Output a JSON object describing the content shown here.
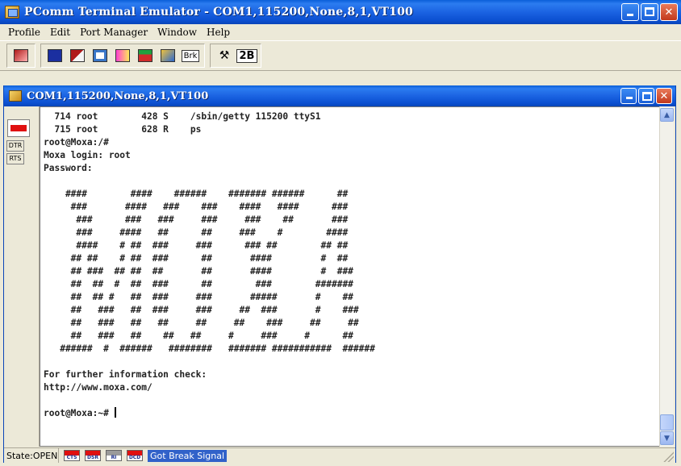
{
  "window": {
    "title": "PComm Terminal Emulator - COM1,115200,None,8,1,VT100",
    "icon": "pcomm-app-icon"
  },
  "menu": {
    "items": [
      {
        "label": "Profile",
        "key": "P"
      },
      {
        "label": "Edit",
        "key": "E"
      },
      {
        "label": "Port Manager",
        "key": "P"
      },
      {
        "label": "Window",
        "key": "W"
      },
      {
        "label": "Help",
        "key": "H"
      }
    ]
  },
  "toolbar": {
    "brk_label": "Brk",
    "twob_label": "2B",
    "icons": [
      "back-icon",
      "save-icon",
      "disconnect-icon",
      "properties-icon",
      "connect-icon",
      "capture-icon",
      "transfer-icon",
      "break-icon",
      "scope-icon",
      "2b-icon"
    ]
  },
  "session": {
    "title": "COM1,115200,None,8,1,VT100"
  },
  "panel": {
    "dtr_label": "DTR",
    "rts_label": "RTS"
  },
  "terminal": {
    "lines": [
      "  714 root        428 S    /sbin/getty 115200 ttyS1",
      "  715 root        628 R    ps",
      "root@Moxa:/#",
      "Moxa login: root",
      "Password:",
      "",
      "    ####        ####    ######    ####### ######      ##",
      "     ###       ####   ###    ###    ####   ####      ###",
      "      ###      ###   ###     ###     ###    ##       ###",
      "      ###     ####   ##      ##     ###    #        ####",
      "      ####    # ##  ###     ###      ### ##        ## ##",
      "     ## ##    # ##  ###      ##       ####         #  ##",
      "     ## ###  ## ##  ##       ##       ####         #  ###",
      "     ##  ##  #  ##  ###      ##        ###        #######",
      "     ##  ## #   ##  ###     ###       #####       #    ##",
      "     ##   ###   ##  ###     ###     ##  ###       #    ###",
      "     ##   ###   ##   ##     ##     ##    ###     ##     ##",
      "     ##   ###   ##    ##   ##     #     ###     #      ##",
      "   ######  #  ######   ########   ####### ###########  ######",
      "",
      "For further information check:",
      "http://www.moxa.com/",
      "",
      "root@Moxa:~# "
    ]
  },
  "status": {
    "state": "State:OPEN",
    "leds": [
      {
        "label": "CTS",
        "color": "#e01010"
      },
      {
        "label": "DSR",
        "color": "#e01010"
      },
      {
        "label": "RI",
        "color": "#9a9a9a"
      },
      {
        "label": "DCD",
        "color": "#e01010"
      }
    ],
    "message": "Got Break Signal"
  }
}
